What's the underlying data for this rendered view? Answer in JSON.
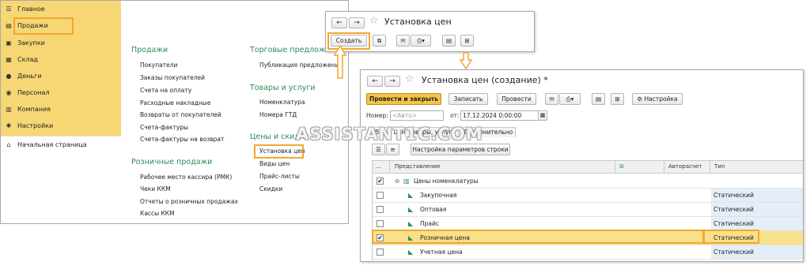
{
  "left_window": {
    "sidebar": {
      "items": [
        {
          "icon": "menu-icon",
          "label": "Главное"
        },
        {
          "icon": "cash-register-icon",
          "label": "Продажи"
        },
        {
          "icon": "cart-icon",
          "label": "Закупки"
        },
        {
          "icon": "warehouse-icon",
          "label": "Склад"
        },
        {
          "icon": "money-icon",
          "label": "Деньги"
        },
        {
          "icon": "person-icon",
          "label": "Персонал"
        },
        {
          "icon": "company-icon",
          "label": "Компания"
        },
        {
          "icon": "gear-icon",
          "label": "Настройки"
        }
      ],
      "home": {
        "icon": "home-icon",
        "label": "Начальная страница"
      }
    },
    "sections": {
      "sales": {
        "title": "Продажи",
        "links": [
          "Покупатели",
          "Заказы покупателей",
          "Счета на оплату",
          "Расходные накладные",
          "Возвраты от покупателей",
          "Счета-фактуры",
          "Счета-фактуры на возврат"
        ]
      },
      "retail": {
        "title": "Розничные продажи",
        "links": [
          "Рабочее место кассира (РМК)",
          "Чеки ККМ",
          "Отчеты о розничных продажах",
          "Кассы ККМ"
        ]
      },
      "trade": {
        "title": "Торговые предложения",
        "links": [
          "Публикация предложений"
        ]
      },
      "goods": {
        "title": "Товары и услуги",
        "links": [
          "Номенклатура",
          "Номера ГТД"
        ]
      },
      "prices": {
        "title": "Цены и скидки",
        "links": [
          "Установка цен",
          "Виды цен",
          "Прайс-листы",
          "Скидки"
        ]
      }
    }
  },
  "small_window": {
    "title": "Установка цен",
    "create_label": "Создать"
  },
  "big_window": {
    "title": "Установка цен (создание) *",
    "toolbar": {
      "post_close": "Провести и закрыть",
      "save": "Записать",
      "post": "Провести",
      "settings": "Настройка"
    },
    "number_label": "Номер:",
    "number_placeholder": "<Авто>",
    "from_label": "от:",
    "date_value": "17.12.2024  0:00:00",
    "tabs": [
      "Виды цен",
      "Товары, услуги",
      "Дополнительно"
    ],
    "row_settings": "Настройка параметров строки",
    "columns": {
      "dots": "...",
      "view": "Представление",
      "autocalc": "Авторасчет",
      "type": "Тип"
    },
    "group": {
      "label": "Цены номенклатуры",
      "checked": "✔"
    },
    "rows": [
      {
        "label": "Закупочная",
        "type": "Статический",
        "checked": ""
      },
      {
        "label": "Оптовая",
        "type": "Статический",
        "checked": ""
      },
      {
        "label": "Прайс",
        "type": "Статический",
        "checked": ""
      },
      {
        "label": "Розничная цена",
        "type": "Статический",
        "checked": "✔"
      },
      {
        "label": "Учетная цена",
        "type": "Статический",
        "checked": ""
      }
    ]
  },
  "watermark": "ASSISTANT1C.COM",
  "colors": {
    "accent": "#f2a72e",
    "sidebar": "#f7d674",
    "section_title": "#2e8b57",
    "selected_row": "#f9e08a"
  }
}
